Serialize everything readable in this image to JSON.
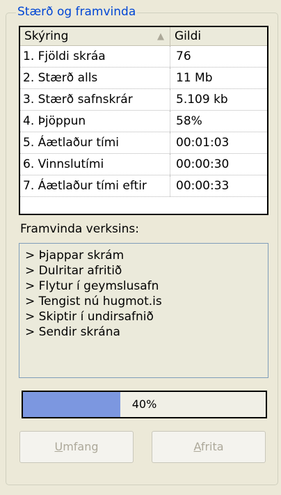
{
  "group": {
    "title": "Stærð og framvinda"
  },
  "list": {
    "columns": [
      "Skýring",
      "Gildi"
    ],
    "sort_indicator": "▲",
    "rows": [
      {
        "label": "1. Fjöldi skráa",
        "value": "76"
      },
      {
        "label": "2. Stærð alls",
        "value": "11 Mb"
      },
      {
        "label": "3. Stærð safnskrár",
        "value": "5.109 kb"
      },
      {
        "label": "4. Þjöppun",
        "value": "58%"
      },
      {
        "label": "5. Áætlaður tími",
        "value": "00:01:03"
      },
      {
        "label": "6. Vinnslutími",
        "value": "00:00:30"
      },
      {
        "label": "7. Áætlaður tími eftir",
        "value": "00:00:33"
      }
    ]
  },
  "progress": {
    "label": "Framvinda verksins:",
    "log": [
      "> Þjappar skrám",
      "> Dulritar afritið",
      "> Flytur í geymslusafn",
      "> Tengist nú hugmot.is",
      "> Skiptir í undirsafnið",
      "> Sendir skrána"
    ],
    "percent": 40,
    "percent_text": "40%",
    "fill_color": "#7c97e0"
  },
  "buttons": {
    "scope_first": "U",
    "scope_rest": "mfang",
    "copy_first": "A",
    "copy_rest": "frita"
  }
}
